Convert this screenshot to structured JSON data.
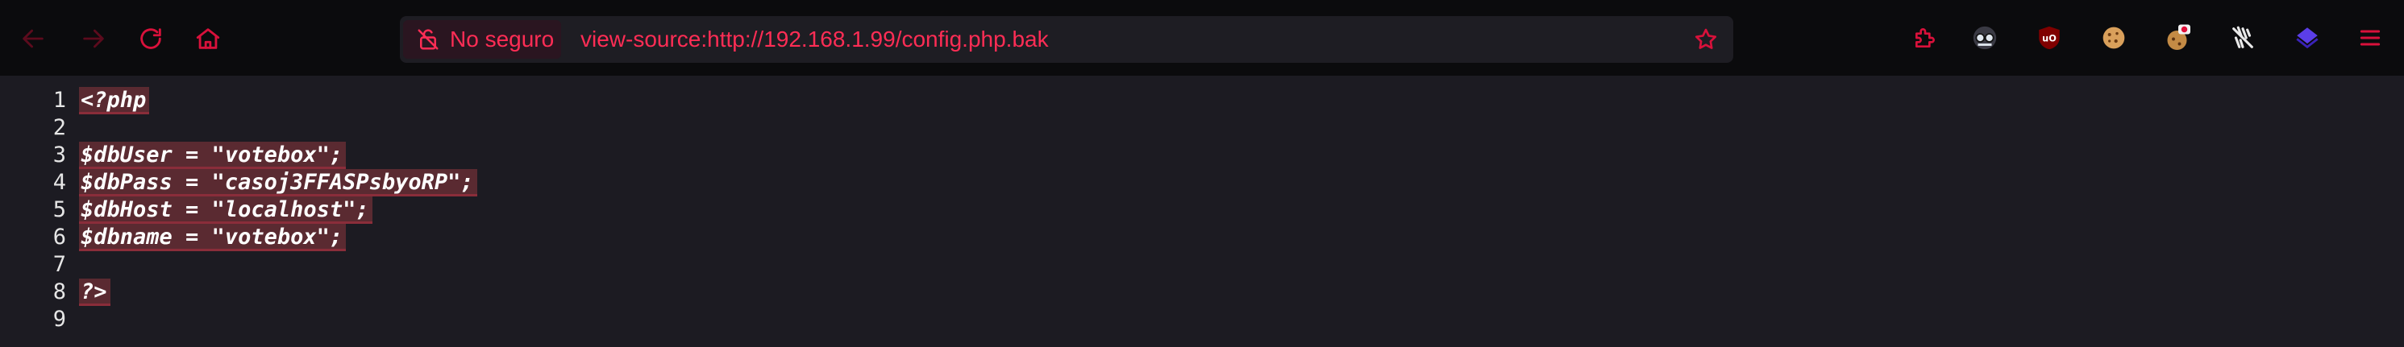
{
  "colors": {
    "accent": "#d9113b",
    "toolbar_bg": "#0b0b0d",
    "page_bg": "#1c1b22",
    "code_highlight": "#5a2a31"
  },
  "toolbar": {
    "back_icon": "arrow-left-icon",
    "forward_icon": "arrow-right-icon",
    "reload_icon": "reload-icon",
    "home_icon": "home-icon"
  },
  "urlbar": {
    "security_label": "No seguro",
    "url": "view-source:http://192.168.1.99/config.php.bak",
    "bookmark_icon": "star-icon"
  },
  "extensions": [
    {
      "name": "extensions-puzzle-icon"
    },
    {
      "name": "spy-glasses-icon"
    },
    {
      "name": "ublock-origin-icon"
    },
    {
      "name": "cookie-icon"
    },
    {
      "name": "cookie-editor-icon"
    },
    {
      "name": "wappalyzer-icon"
    },
    {
      "name": "foxyproxy-icon"
    },
    {
      "name": "menu-icon"
    }
  ],
  "source_lines": [
    {
      "number": "1",
      "code": "<?php"
    },
    {
      "number": "2",
      "code": ""
    },
    {
      "number": "3",
      "code": "$dbUser = \"votebox\";"
    },
    {
      "number": "4",
      "code": "$dbPass = \"casoj3FFASPsbyoRP\";"
    },
    {
      "number": "5",
      "code": "$dbHost = \"localhost\";"
    },
    {
      "number": "6",
      "code": "$dbname = \"votebox\";"
    },
    {
      "number": "7",
      "code": ""
    },
    {
      "number": "8",
      "code": "?>"
    },
    {
      "number": "9",
      "code": ""
    }
  ]
}
